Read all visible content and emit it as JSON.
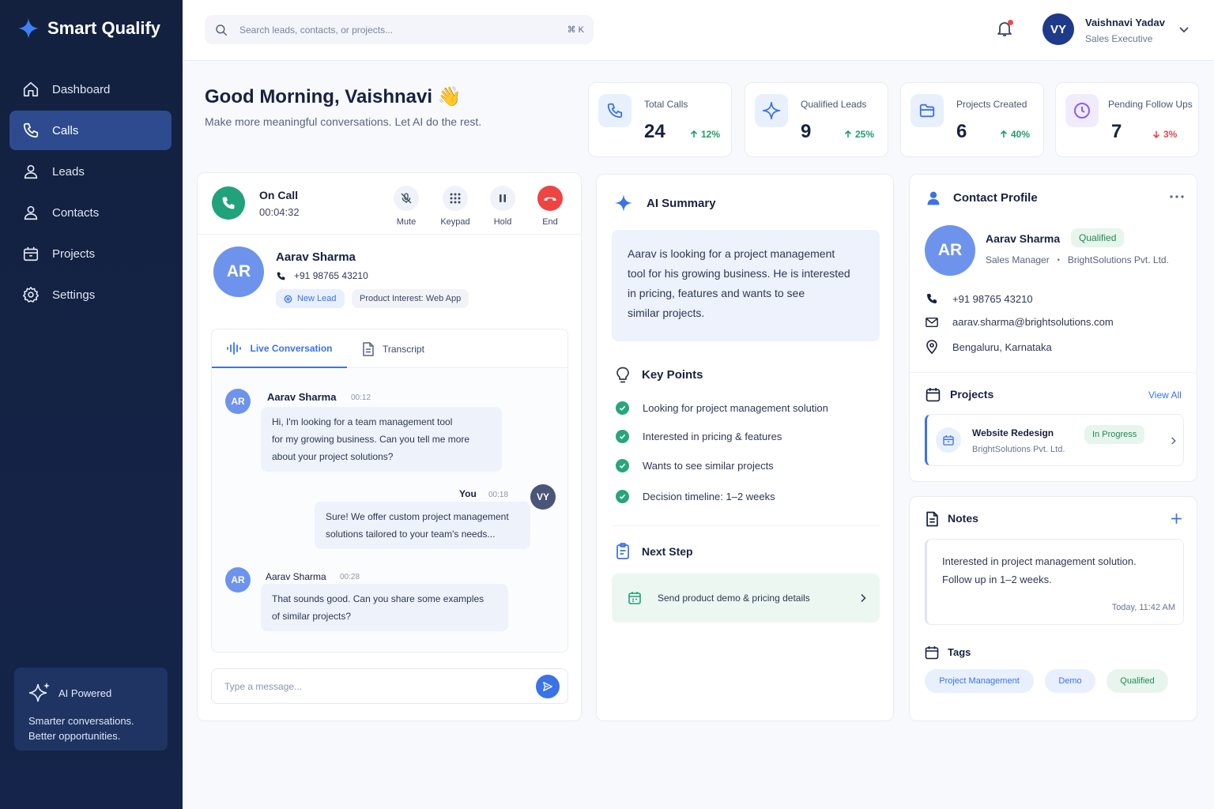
{
  "brand": {
    "name": "Smart Qualify",
    "accent": "#3b72e8"
  },
  "sidebar": {
    "items": [
      {
        "label": "Dashboard",
        "icon": "home-icon"
      },
      {
        "label": "Calls",
        "icon": "phone-icon",
        "active": true
      },
      {
        "label": "Leads",
        "icon": "user-icon"
      },
      {
        "label": "Contacts",
        "icon": "user-icon"
      },
      {
        "label": "Projects",
        "icon": "briefcase-icon"
      },
      {
        "label": "Settings",
        "icon": "gear-icon"
      }
    ],
    "ai_card": {
      "title": "AI Powered",
      "text_line1": "Smarter conversations.",
      "text_line2": "Better opportunities."
    }
  },
  "header": {
    "search_placeholder": "Search leads, contacts, or projects...",
    "shortcut": "⌘ K",
    "user": {
      "initials": "VY",
      "name": "Vaishnavi Yadav",
      "role": "Sales Executive"
    }
  },
  "greeting": {
    "title": "Good Morning, Vaishnavi 👋",
    "subtitle": "Make more meaningful conversations. Let AI do the rest."
  },
  "stats": [
    {
      "label": "Total Calls",
      "value": "24",
      "change": "12%",
      "direction": "up",
      "icon": "phone-icon",
      "color": "#3b72e8"
    },
    {
      "label": "Qualified Leads",
      "value": "9",
      "change": "25%",
      "direction": "up",
      "icon": "sparkle-icon",
      "color": "#3b72e8"
    },
    {
      "label": "Projects Created",
      "value": "6",
      "change": "40%",
      "direction": "up",
      "icon": "folder-icon",
      "color": "#3b72e8"
    },
    {
      "label": "Pending Follow Ups",
      "value": "7",
      "change": "3%",
      "direction": "down",
      "icon": "clock-icon",
      "color": "#8b5cf6"
    }
  ],
  "call": {
    "status": "On Call",
    "timer": "00:04:32",
    "controls": {
      "mute": "Mute",
      "keypad": "Keypad",
      "hold": "Hold",
      "end": "End"
    },
    "caller": {
      "initials": "AR",
      "name": "Aarav Sharma",
      "phone": "+91 98765 43210",
      "badge": "New Lead",
      "interest": "Product Interest: Web App"
    },
    "tabs": {
      "live": "Live Conversation",
      "transcript": "Transcript"
    },
    "messages": [
      {
        "initials": "AR",
        "name": "Aarav Sharma",
        "time": "00:12",
        "text_lines": [
          "Hi, I'm looking for a team management tool",
          "for my growing business. Can you tell me more",
          "about your project solutions?"
        ]
      },
      {
        "initials": "VY",
        "name": "You",
        "time": "00:18",
        "text_lines": [
          "Sure! We offer custom project management",
          "solutions tailored to your team's needs..."
        ]
      },
      {
        "initials": "AR",
        "name": "Aarav Sharma",
        "time": "00:28",
        "text_lines": [
          "That sounds good. Can you share some examples",
          "of similar projects?"
        ]
      }
    ],
    "composer_placeholder": "Type a message..."
  },
  "ai_summary": {
    "title": "AI Summary",
    "summary_lines": [
      "Aarav is looking for a project management",
      "tool for his growing business. He is interested",
      "in pricing, features and wants to see",
      "similar projects."
    ],
    "key_points_title": "Key Points",
    "key_points": [
      "Looking for project management solution",
      "Interested in pricing & features",
      "Wants to see similar projects",
      "Decision timeline: 1–2 weeks"
    ],
    "next_step_title": "Next Step",
    "next_step": "Send product demo & pricing details"
  },
  "contact": {
    "title": "Contact Profile",
    "initials": "AR",
    "name": "Aarav Sharma",
    "status": "Qualified",
    "role": "Sales Manager",
    "company": "BrightSolutions Pvt. Ltd.",
    "phone": "+91 98765 43210",
    "email": "aarav.sharma@brightsolutions.com",
    "location": "Bengaluru, Karnataka",
    "projects_title": "Projects",
    "view_all": "View All",
    "project": {
      "name": "Website Redesign",
      "company": "BrightSolutions Pvt. Ltd.",
      "status": "In Progress"
    }
  },
  "notes": {
    "title": "Notes",
    "line1": "Interested in project management solution.",
    "line2": "Follow up in 1–2 weeks.",
    "time": "Today, 11:42 AM",
    "tags_title": "Tags",
    "tags": [
      "Project Management",
      "Demo",
      "Qualified"
    ]
  }
}
